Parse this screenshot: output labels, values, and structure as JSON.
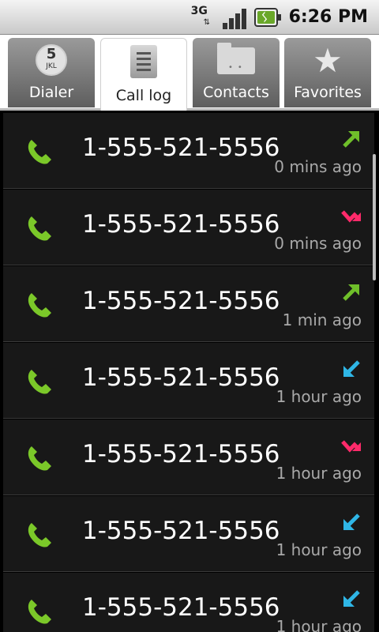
{
  "status_bar": {
    "network": "3G",
    "time": "6:26 PM"
  },
  "tabs": [
    {
      "label": "Dialer",
      "icon": "dialpad-5-jkl-icon",
      "icon_text": "5",
      "icon_subtext": "JKL",
      "active": false
    },
    {
      "label": "Call log",
      "icon": "call-log-list-icon",
      "active": true
    },
    {
      "label": "Contacts",
      "icon": "contacts-folder-icon",
      "active": false
    },
    {
      "label": "Favorites",
      "icon": "star-icon",
      "active": false
    }
  ],
  "colors": {
    "phone_icon": "#7bc829",
    "outgoing_arrow": "#6fbf2a",
    "missed_arrow": "#ff2a6a",
    "incoming_arrow": "#2fb6e6"
  },
  "calls": [
    {
      "number": "1-555-521-5556",
      "time": "0 mins ago",
      "type": "outgoing"
    },
    {
      "number": "1-555-521-5556",
      "time": "0 mins ago",
      "type": "missed"
    },
    {
      "number": "1-555-521-5556",
      "time": "1 min ago",
      "type": "outgoing"
    },
    {
      "number": "1-555-521-5556",
      "time": "1 hour ago",
      "type": "incoming"
    },
    {
      "number": "1-555-521-5556",
      "time": "1 hour ago",
      "type": "missed"
    },
    {
      "number": "1-555-521-5556",
      "time": "1 hour ago",
      "type": "incoming"
    },
    {
      "number": "1-555-521-5556",
      "time": "1 hour ago",
      "type": "incoming"
    }
  ]
}
